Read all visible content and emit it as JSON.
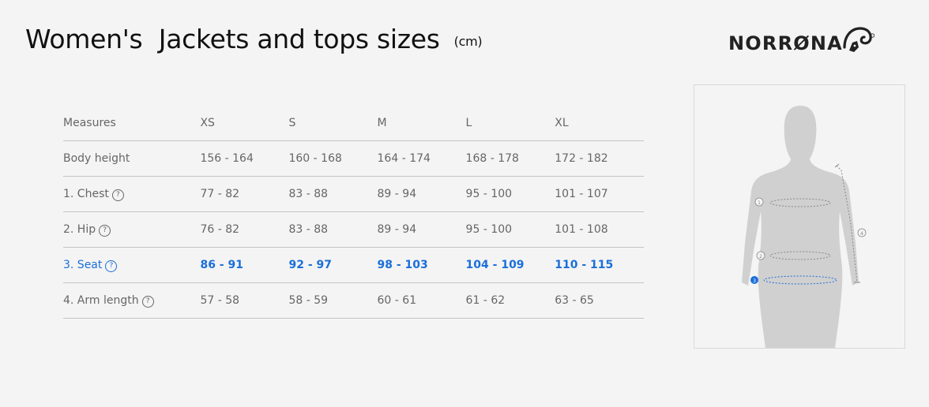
{
  "title": "Women's  Jackets and tops sizes",
  "unit": "(cm)",
  "logo": {
    "wordmark": "NORRØNA"
  },
  "table": {
    "columns": [
      "Measures",
      "XS",
      "S",
      "M",
      "L",
      "XL"
    ],
    "rows": [
      {
        "label": "Body height",
        "has_help": false,
        "values": [
          "156 - 164",
          "160 - 168",
          "164 - 174",
          "168 - 178",
          "172 - 182"
        ]
      },
      {
        "label": "1. Chest",
        "has_help": true,
        "values": [
          "77 - 82",
          "83 - 88",
          "89 - 94",
          "95 - 100",
          "101 - 107"
        ]
      },
      {
        "label": "2. Hip",
        "has_help": true,
        "values": [
          "76 - 82",
          "83 - 88",
          "89 - 94",
          "95 - 100",
          "101 - 108"
        ]
      },
      {
        "label": "3. Seat",
        "has_help": true,
        "values": [
          "86 - 91",
          "92 - 97",
          "98 - 103",
          "104 - 109",
          "110 - 115"
        ],
        "highlighted": true
      },
      {
        "label": "4. Arm length",
        "has_help": true,
        "values": [
          "57 - 58",
          "58 - 59",
          "60 - 61",
          "61 - 62",
          "63 - 65"
        ]
      }
    ],
    "help_glyph": "?"
  },
  "figure": {
    "markers": [
      "1",
      "2",
      "3",
      "4"
    ],
    "active_marker": "3"
  },
  "colors": {
    "accent": "#1a6fd9",
    "text": "#666666",
    "silhouette": "#d0d0d0"
  }
}
